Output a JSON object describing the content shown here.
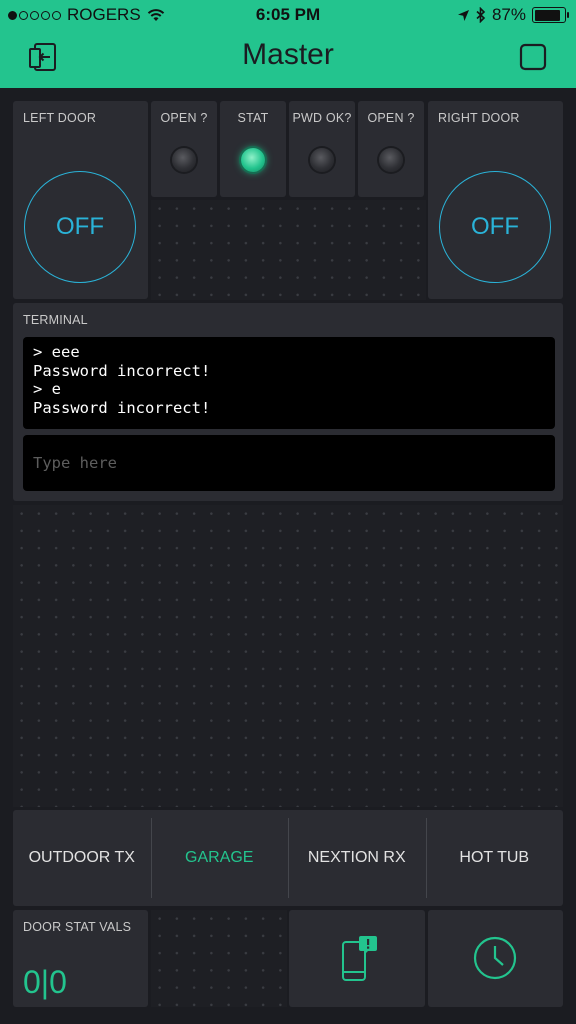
{
  "status": {
    "carrier": "ROGERS",
    "time": "6:05 PM",
    "battery_pct": "87%",
    "battery_level": 0.87,
    "signal_bars_filled": 1
  },
  "header": {
    "title": "Master"
  },
  "widgets": {
    "left_door": {
      "label": "LEFT DOOR",
      "button": "OFF"
    },
    "right_door": {
      "label": "RIGHT DOOR",
      "button": "OFF"
    },
    "leds": [
      {
        "label": "OPEN ?",
        "state": "off"
      },
      {
        "label": "STAT",
        "state": "on"
      },
      {
        "label": "PWD OK?",
        "state": "off"
      },
      {
        "label": "OPEN ?",
        "state": "off"
      }
    ],
    "terminal": {
      "label": "TERMINAL",
      "lines": [
        "> eee",
        "Password incorrect!",
        "> e",
        "Password incorrect!"
      ],
      "input_placeholder": "Type here"
    },
    "tabs": [
      {
        "label": "OUTDOOR TX",
        "active": false
      },
      {
        "label": "GARAGE",
        "active": true
      },
      {
        "label": "NEXTION RX",
        "active": false
      },
      {
        "label": "HOT TUB",
        "active": false
      }
    ],
    "door_stat": {
      "label": "DOOR STAT VALS",
      "value": "0|0"
    }
  },
  "colors": {
    "accent": "#23c48e",
    "button_blue": "#2ab3d8",
    "background": "#1b1c21",
    "panel": "#2b2c32"
  }
}
